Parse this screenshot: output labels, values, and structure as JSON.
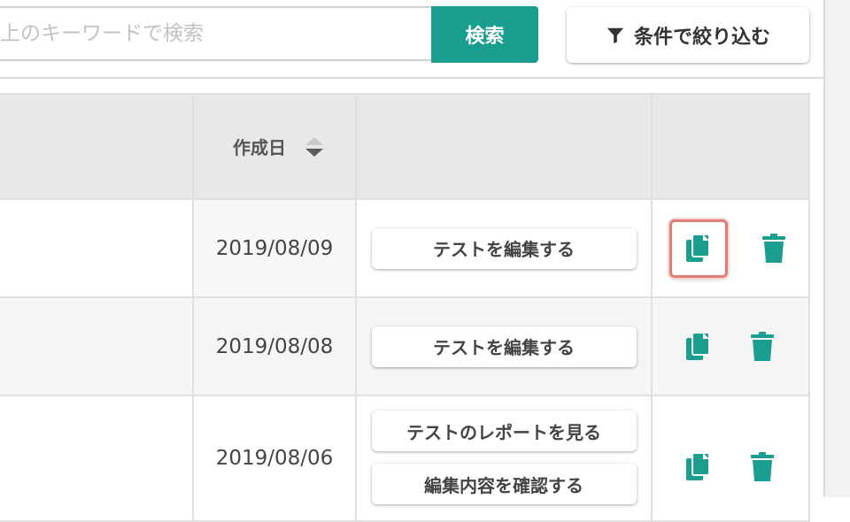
{
  "search": {
    "placeholder": "上のキーワードで検索",
    "button_label": "検索"
  },
  "filter": {
    "label": "条件で絞り込む",
    "icon": "filter-icon"
  },
  "table": {
    "headers": [
      "",
      "作成日",
      "",
      ""
    ],
    "rows": [
      {
        "date": "2019/08/09",
        "actions": [
          "テストを編集する"
        ],
        "copy_highlighted": true
      },
      {
        "date": "2019/08/08",
        "actions": [
          "テストを編集する"
        ],
        "copy_highlighted": false
      },
      {
        "date": "2019/08/06",
        "actions": [
          "テストのレポートを見る",
          "編集内容を確認する"
        ],
        "copy_highlighted": false
      }
    ]
  },
  "colors": {
    "accent": "#1a9e8f",
    "highlight_border": "#e07b76"
  },
  "icons": {
    "copy": "copy-icon",
    "delete": "trash-icon",
    "sort": "sort-icon"
  }
}
